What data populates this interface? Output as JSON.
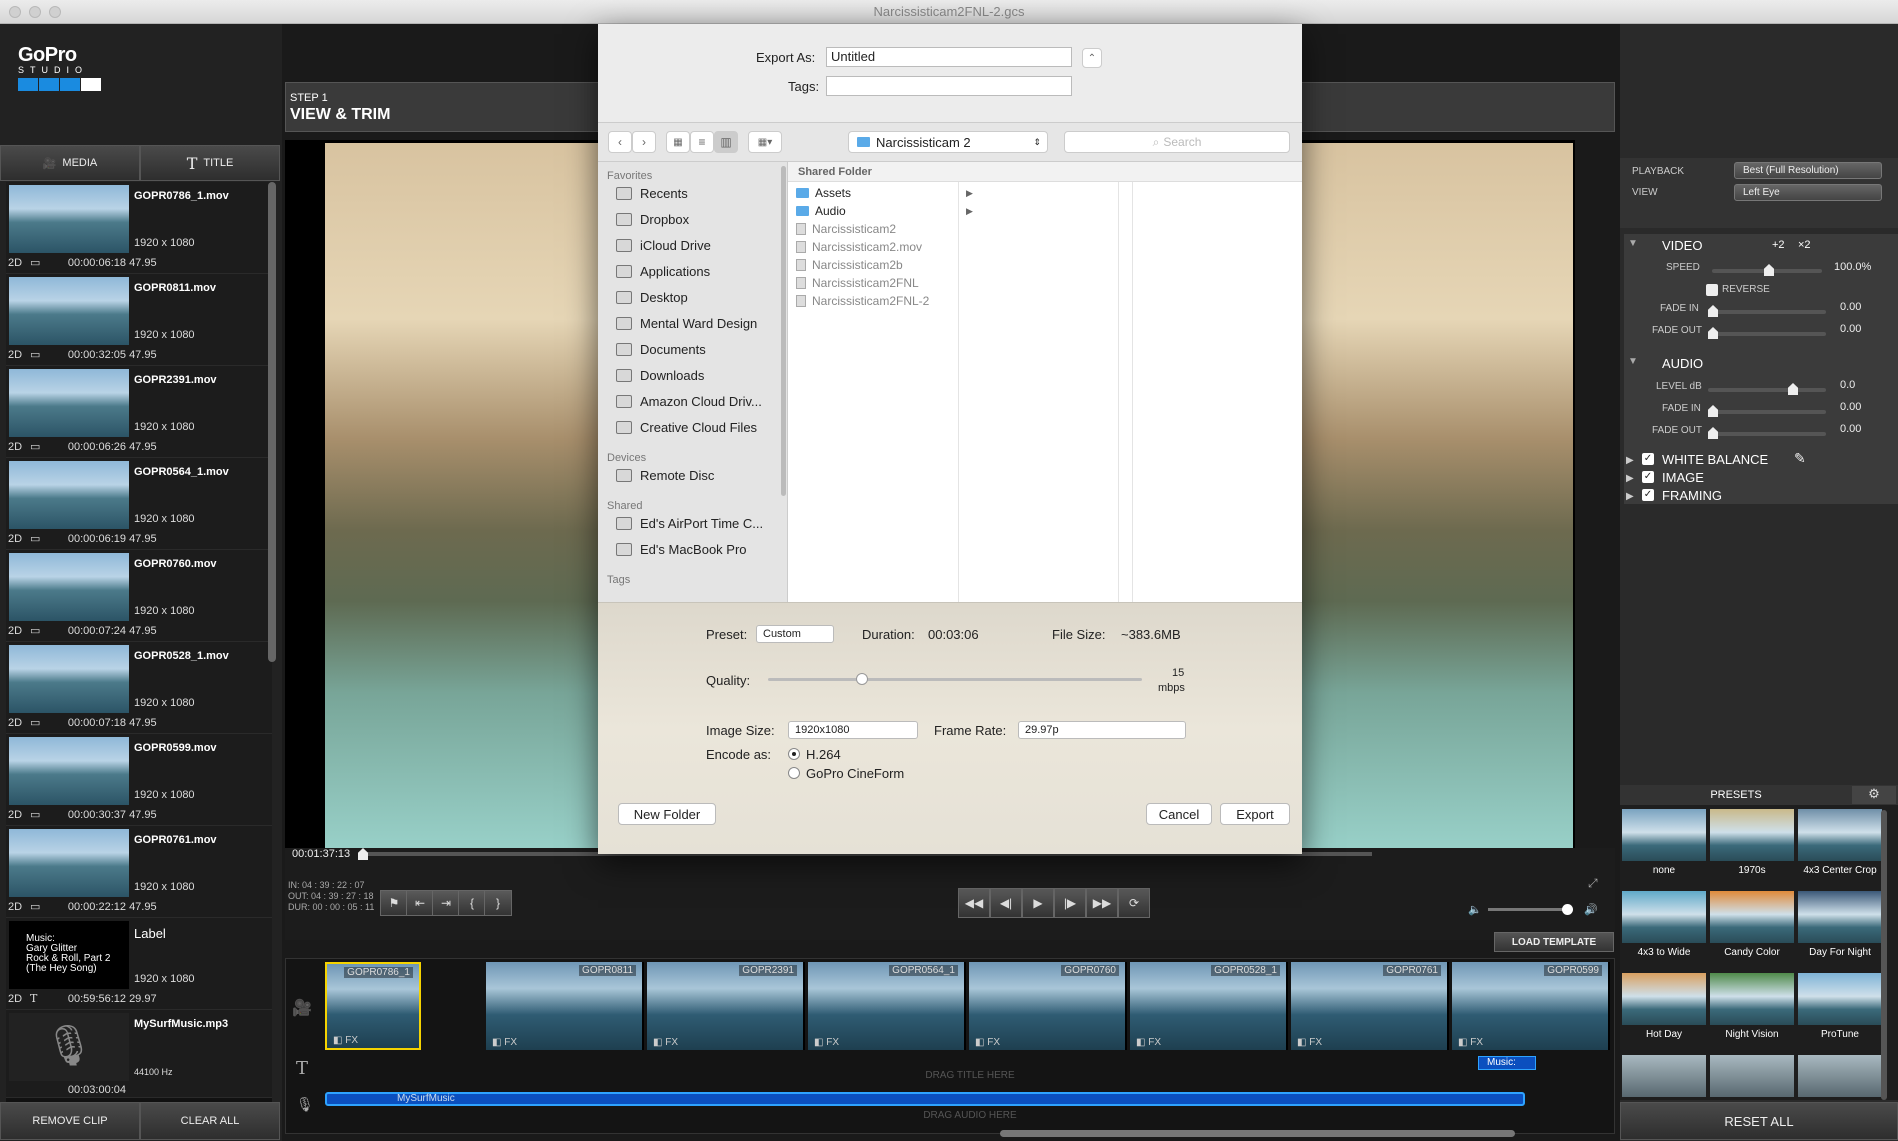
{
  "window": {
    "title": "Narcissisticam2FNL-2.gcs"
  },
  "logo": {
    "word": "GoPro",
    "sub": "STUDIO"
  },
  "step": {
    "label": "STEP 1",
    "title": "VIEW & TRIM"
  },
  "left_tabs": {
    "media": "MEDIA",
    "title": "TITLE"
  },
  "media": [
    {
      "name": "GOPR0786_1.mov",
      "res": "1920 x 1080",
      "mode": "2D",
      "dur": "00:00:06:18",
      "fps": "47.95"
    },
    {
      "name": "GOPR0811.mov",
      "res": "1920 x 1080",
      "mode": "2D",
      "dur": "00:00:32:05",
      "fps": "47.95"
    },
    {
      "name": "GOPR2391.mov",
      "res": "1920 x 1080",
      "mode": "2D",
      "dur": "00:00:06:26",
      "fps": "47.95"
    },
    {
      "name": "GOPR0564_1.mov",
      "res": "1920 x 1080",
      "mode": "2D",
      "dur": "00:00:06:19",
      "fps": "47.95"
    },
    {
      "name": "GOPR0760.mov",
      "res": "1920 x 1080",
      "mode": "2D",
      "dur": "00:00:07:24",
      "fps": "47.95"
    },
    {
      "name": "GOPR0528_1.mov",
      "res": "1920 x 1080",
      "mode": "2D",
      "dur": "00:00:07:18",
      "fps": "47.95"
    },
    {
      "name": "GOPR0599.mov",
      "res": "1920 x 1080",
      "mode": "2D",
      "dur": "00:00:30:37",
      "fps": "47.95"
    },
    {
      "name": "GOPR0761.mov",
      "res": "1920 x 1080",
      "mode": "2D",
      "dur": "00:00:22:12",
      "fps": "47.95"
    }
  ],
  "title_item": {
    "label": "Label",
    "text": "Music:\nGary Glitter\nRock & Roll, Part 2\n(The Hey Song)",
    "res": "1920 x 1080",
    "mode": "2D",
    "dur": "00:59:56:12",
    "fps": "29.97"
  },
  "music_item": {
    "name": "MySurfMusic.mp3",
    "hz": "44100 Hz",
    "dur": "00:03:00:04"
  },
  "left_buttons": {
    "remove": "REMOVE CLIP",
    "clear": "CLEAR ALL"
  },
  "transport": {
    "timecode": "00:01:37:13",
    "in": "IN: 04 : 39 : 22 : 07",
    "out": "OUT: 04 : 39 : 27 : 18",
    "dur": "DUR: 00 : 00 : 05 : 11"
  },
  "load_template": "LOAD TEMPLATE",
  "timeline": {
    "clips": [
      "GOPR0786_1",
      "GOPR0811",
      "GOPR2391",
      "GOPR0564_1",
      "GOPR0760",
      "GOPR0528_1",
      "GOPR0761",
      "GOPR0599"
    ],
    "fx": "FX",
    "drag_title": "DRAG TITLE HERE",
    "audio_track": "MySurfMusic",
    "drag_audio": "DRAG AUDIO HERE",
    "music_tag": "Music:"
  },
  "right": {
    "playback_label": "PLAYBACK",
    "playback_value": "Best (Full Resolution)",
    "view_label": "VIEW",
    "view_value": "Left Eye",
    "video": "VIDEO",
    "x2a": "+2",
    "x2b": "×2",
    "speed_label": "SPEED",
    "speed_value": "100.0%",
    "reverse": "REVERSE",
    "vfade_in": "FADE IN",
    "vfade_in_val": "0.00",
    "vfade_out": "FADE OUT",
    "vfade_out_val": "0.00",
    "audio": "AUDIO",
    "level_label": "LEVEL dB",
    "level_val": "0.0",
    "afade_in": "FADE IN",
    "afade_in_val": "0.00",
    "afade_out": "FADE OUT",
    "afade_out_val": "0.00",
    "white_balance": "WHITE BALANCE",
    "image": "IMAGE",
    "framing": "FRAMING",
    "presets_title": "PRESETS",
    "presets": [
      "none",
      "1970s",
      "4x3 Center Crop",
      "4x3 to Wide",
      "Candy Color",
      "Day For Night",
      "Hot Day",
      "Night Vision",
      "ProTune"
    ],
    "reset": "RESET ALL"
  },
  "dialog": {
    "export_as_label": "Export As:",
    "export_as_value": "Untitled",
    "tags_label": "Tags:",
    "location": "Narcissisticam 2",
    "search_placeholder": "Search",
    "favorites_header": "Favorites",
    "favorites": [
      "Recents",
      "Dropbox",
      "iCloud Drive",
      "Applications",
      "Desktop",
      "Mental Ward Design",
      "Documents",
      "Downloads",
      "Amazon Cloud Driv...",
      "Creative Cloud Files"
    ],
    "devices_header": "Devices",
    "devices": [
      "Remote Disc"
    ],
    "shared_header": "Shared",
    "shared": [
      "Ed's AirPort Time C...",
      "Ed's MacBook Pro"
    ],
    "tags_header": "Tags",
    "folder_header": "Shared Folder",
    "files": [
      {
        "name": "Assets",
        "type": "folder"
      },
      {
        "name": "Audio",
        "type": "folder"
      },
      {
        "name": "Narcissisticam2",
        "type": "doc"
      },
      {
        "name": "Narcissisticam2.mov",
        "type": "doc"
      },
      {
        "name": "Narcissisticam2b",
        "type": "doc"
      },
      {
        "name": "Narcissisticam2FNL",
        "type": "doc"
      },
      {
        "name": "Narcissisticam2FNL-2",
        "type": "doc"
      }
    ],
    "preset_label": "Preset:",
    "preset_value": "Custom",
    "duration_label": "Duration:",
    "duration_value": "00:03:06",
    "filesize_label": "File Size:",
    "filesize_value": "~383.6MB",
    "quality_label": "Quality:",
    "quality_value": "15",
    "quality_unit": "mbps",
    "quality_level": 0.25,
    "imagesize_label": "Image Size:",
    "imagesize_value": "1920x1080",
    "framerate_label": "Frame Rate:",
    "framerate_value": "29.97p",
    "encode_label": "Encode as:",
    "encode_h264": "H.264",
    "encode_cineform": "GoPro CineForm",
    "new_folder": "New Folder",
    "cancel": "Cancel",
    "export": "Export"
  },
  "colors": {
    "accent_blue": "#0b4fbf",
    "logo_blue": "#1a8be0"
  }
}
